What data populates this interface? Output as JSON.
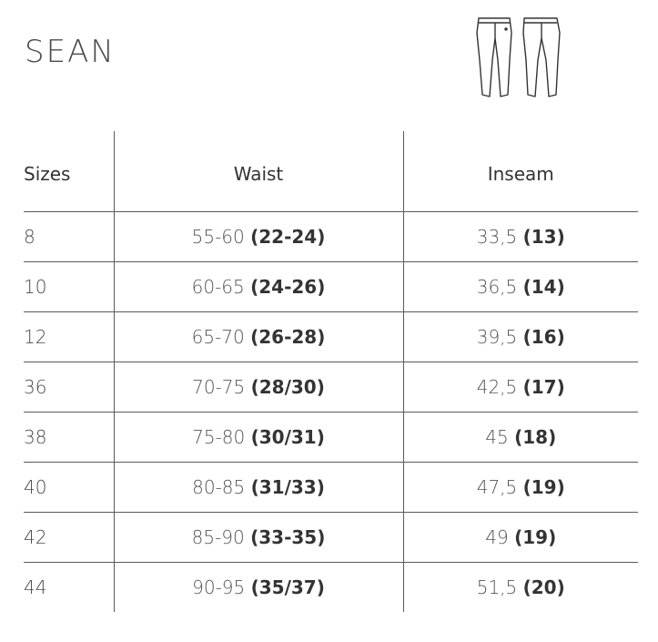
{
  "title": "SEAN",
  "icon": "pants-front-back-icon",
  "table": {
    "headers": {
      "sizes": "Sizes",
      "waist": "Waist",
      "inseam": "Inseam"
    },
    "rows": [
      {
        "size": "8",
        "waist_cm": "55-60",
        "waist_in": "(22-24)",
        "inseam_cm": "33,5",
        "inseam_in": "(13)"
      },
      {
        "size": "10",
        "waist_cm": "60-65",
        "waist_in": "(24-26)",
        "inseam_cm": "36,5",
        "inseam_in": "(14)"
      },
      {
        "size": "12",
        "waist_cm": "65-70",
        "waist_in": "(26-28)",
        "inseam_cm": "39,5",
        "inseam_in": "(16)"
      },
      {
        "size": "36",
        "waist_cm": "70-75",
        "waist_in": "(28/30)",
        "inseam_cm": "42,5",
        "inseam_in": "(17)"
      },
      {
        "size": "38",
        "waist_cm": "75-80",
        "waist_in": "(30/31)",
        "inseam_cm": "45",
        "inseam_in": "(18)"
      },
      {
        "size": "40",
        "waist_cm": "80-85",
        "waist_in": "(31/33)",
        "inseam_cm": "47,5",
        "inseam_in": "(19)"
      },
      {
        "size": "42",
        "waist_cm": "85-90",
        "waist_in": "(33-35)",
        "inseam_cm": "49",
        "inseam_in": "(19)"
      },
      {
        "size": "44",
        "waist_cm": "90-95",
        "waist_in": "(35/37)",
        "inseam_cm": "51,5",
        "inseam_in": "(20)"
      }
    ]
  }
}
